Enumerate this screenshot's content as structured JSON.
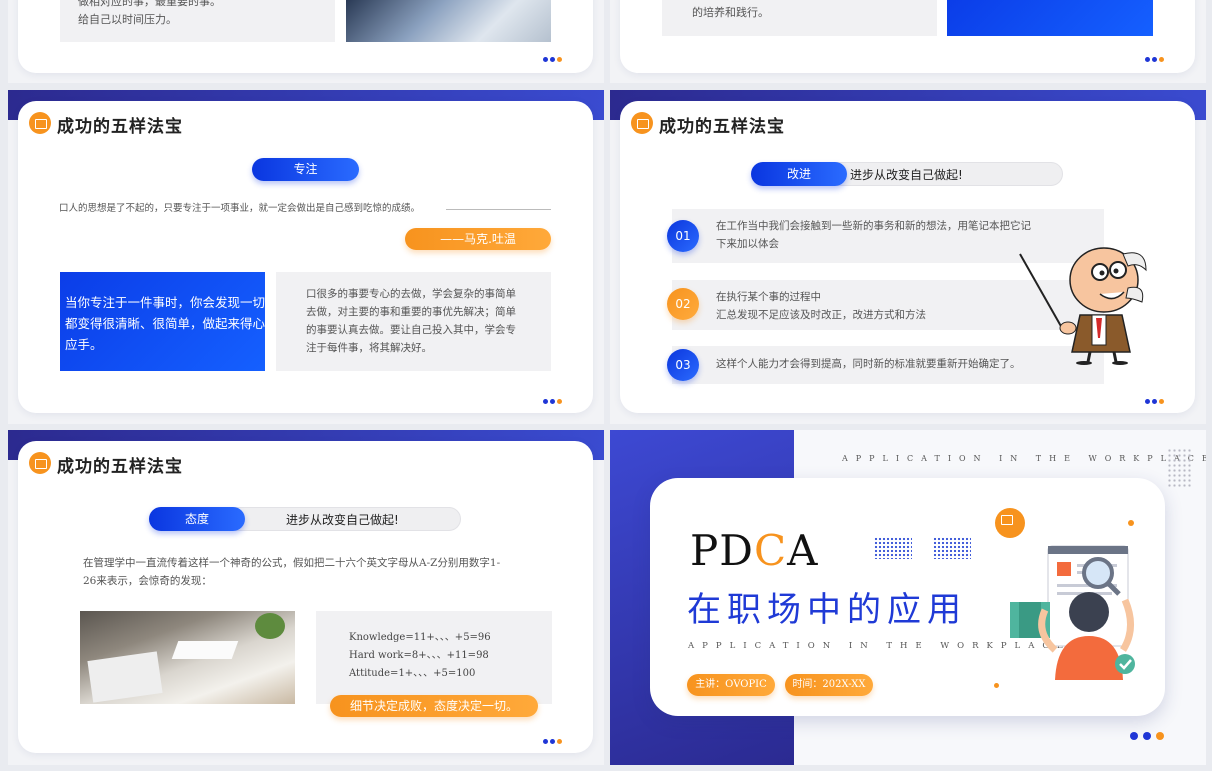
{
  "panel1": {
    "text_line1": "做相对应的事，最重要的事。",
    "text_line2": "给自己以时间压力。"
  },
  "panel2": {
    "text_line1": "的培养和践行。"
  },
  "slide3": {
    "title": "成功的五样法宝",
    "pill": "专注",
    "quote": "口人的思想是了不起的，只要专注于一项事业，就一定会做出是自己感到吃惊的成绩。",
    "author": "——马克.吐温",
    "blue_text": "当你专注于一件事时，你会发现一切都变得很清晰、很简单，做起来得心应手。",
    "gray_text": "口很多的事要专心的去做，学会复杂的事简单去做，对主要的事和重要的事优先解决；简单的事要认真去做。要让自己投入其中，学会专注于每件事，将其解决好。"
  },
  "slide4": {
    "title": "成功的五样法宝",
    "pill_left": "改进",
    "pill_right": "进步从改变自己做起!",
    "items": [
      {
        "num": "01",
        "line1": "在工作当中我们会接触到一些新的事务和新的想法，用笔记本把它记",
        "line2": "下来加以体会"
      },
      {
        "num": "02",
        "line1": "在执行某个事的过程中",
        "line2": "汇总发现不足应该及时改正，改进方式和方法"
      },
      {
        "num": "03",
        "line1": "这样个人能力才会得到提高，同时新的标准就要重新开始确定了。",
        "line2": ""
      }
    ]
  },
  "slide5": {
    "title": "成功的五样法宝",
    "pill_left": "态度",
    "pill_right": "进步从改变自己做起!",
    "intro_line1": "在管理学中一直流传着这样一个神奇的公式，假如把二十六个英文字母从A-Z分别用数字1-",
    "intro_line2": "26来表示，会惊奇的发现：",
    "formulas": [
      "Knowledge=11+、、、+5=96",
      "Hard work=8+、、、+11=98",
      "Attitude=1+、、、+5=100"
    ],
    "conclusion": "细节决定成败，态度决定一切。"
  },
  "slide6": {
    "top_tag": "APPLICATION IN THE WORKPLACE",
    "title_en_1": "PD",
    "title_en_2": "C",
    "title_en_3": "A",
    "title_cn": "在职场中的应用",
    "subtitle": "APPLICATION IN THE WORKPLACE",
    "speaker": "主讲：OVOPIC",
    "time": "时间：202X-XX"
  },
  "colors": {
    "blue": "#1f36d6",
    "orange": "#f7931e",
    "navy": "#2c2a8f"
  }
}
